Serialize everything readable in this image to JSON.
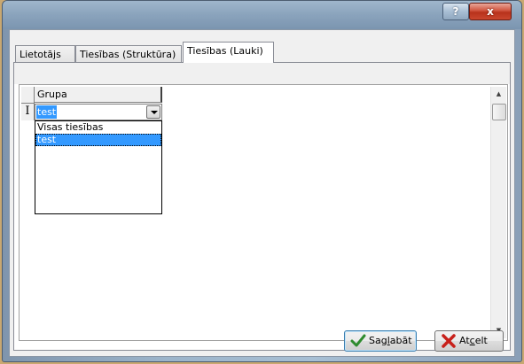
{
  "window": {
    "help_glyph": "?",
    "close_glyph": "x"
  },
  "tabs": [
    {
      "label": "Lietotājs",
      "active": false
    },
    {
      "label": "Tiesības (Struktūra)",
      "active": false
    },
    {
      "label": "Tiesības (Lauki)",
      "active": true
    }
  ],
  "grid": {
    "column_header": "Grupa",
    "row_indicator": "I",
    "current_value": "test",
    "dropdown_options": [
      "Visas tiesības",
      "test"
    ],
    "selected_option": "test"
  },
  "buttons": {
    "save": {
      "pre": "Sag",
      "mnemonic": "l",
      "post": "abāt"
    },
    "cancel": {
      "pre": "At",
      "mnemonic": "c",
      "post": "elt"
    }
  },
  "colors": {
    "selection": "#3399ff",
    "save_icon": "#2e8b2e",
    "cancel_icon": "#c8201a"
  }
}
